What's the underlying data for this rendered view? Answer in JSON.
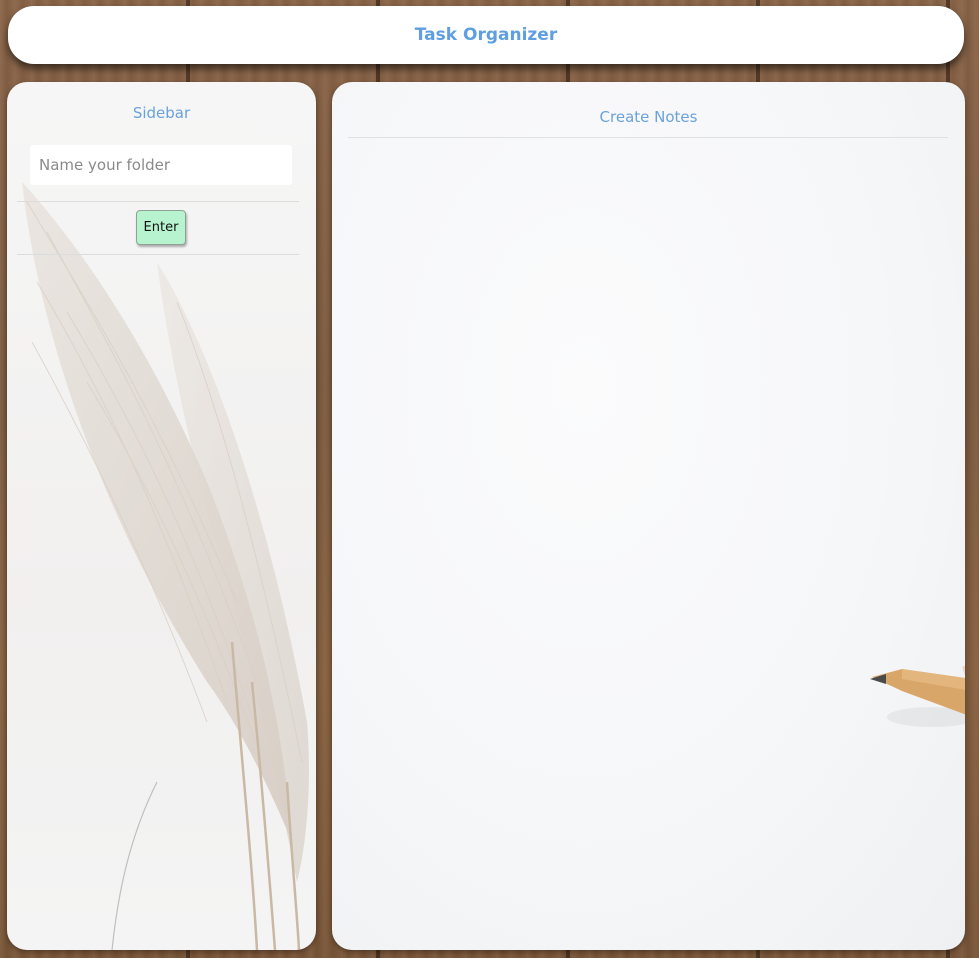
{
  "header": {
    "title": "Task Organizer"
  },
  "sidebar": {
    "title": "Sidebar",
    "folder_input": {
      "placeholder": "Name your folder",
      "value": ""
    },
    "enter_label": "Enter"
  },
  "main": {
    "title": "Create Notes"
  },
  "colors": {
    "accent": "#5f9ee0",
    "button_bg": "#b8f3cf",
    "panel_bg": "#ffffff",
    "wood": "#7c5a3f"
  },
  "icons": {
    "sidebar_background": "pampas-grass-photo",
    "main_background": "pencil-on-paper-photo"
  }
}
